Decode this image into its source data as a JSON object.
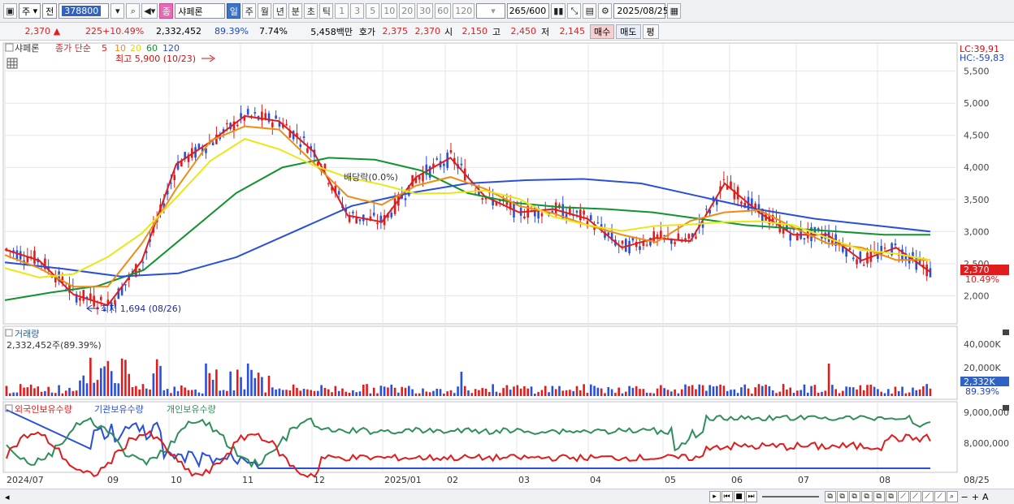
{
  "toolbar": {
    "tab_ju": "주",
    "tab_jeon": "전",
    "code": "378800",
    "name_badge": "종",
    "stock_name": "샤페론",
    "periods": [
      "일",
      "주",
      "월",
      "년",
      "분",
      "초",
      "틱"
    ],
    "intervals": [
      "1",
      "3",
      "5",
      "10",
      "20",
      "30",
      "60",
      "120"
    ],
    "count": "265",
    "count_total": "/600",
    "date": "2025/08/25"
  },
  "quote": {
    "price": "2,370",
    "arrow": "▲",
    "change": "225",
    "change_pct": "+10.49%",
    "volume": "2,332,452",
    "vol_ratio": "89.39%",
    "turnover": "7.74%",
    "amount": "5,458백만",
    "ask_label": "호가",
    "ask1": "2,375",
    "ask2": "2,370",
    "open_label": "시",
    "open": "2,150",
    "high_label": "고",
    "high": "2,450",
    "low_label": "저",
    "low": "2,145",
    "buy": "매수",
    "sell": "매도",
    "avg": "평"
  },
  "price_chart": {
    "stock_label": "샤페론",
    "ma_title": "종가 단순",
    "ma_periods": [
      "5",
      "10",
      "20",
      "60",
      "120"
    ],
    "ma_colors": [
      "#e01c1c",
      "#f08c14",
      "#e8e818",
      "#13922f",
      "#2a4fd8"
    ],
    "high_annot": "최고 5,900 (10/23)",
    "low_annot": "최저 1,694 (08/26)",
    "dividend_annot": "배당락(0.0%)",
    "lc": "LC:39,91",
    "hc": "HC:-59,83",
    "y_ticks": [
      "5,500",
      "5,000",
      "4,500",
      "4,000",
      "3,500",
      "3,000",
      "2,500",
      "2,000"
    ],
    "last_price": "2,370",
    "last_pct": "10.49%"
  },
  "volume_chart": {
    "title": "거래량",
    "value": "2,332,452주(89.39%)",
    "y_ticks": [
      "40,000K",
      "20,000K"
    ],
    "last": "2,332K",
    "last_pct": "89.39%"
  },
  "holding_chart": {
    "legend": [
      "외국인보유수량",
      "기관보유수량",
      "개인보유수량"
    ],
    "legend_colors": [
      "#e01c1c",
      "#2a4fd8",
      "#2f8f5a"
    ],
    "y_ticks": [
      "9,000,000",
      "8,000,000"
    ]
  },
  "x_axis": {
    "labels": [
      "2024/07",
      "09",
      "10",
      "11",
      "12",
      "2025/01",
      "02",
      "03",
      "04",
      "05",
      "06",
      "07",
      "08"
    ],
    "last_label": "08/25"
  },
  "chart_data": {
    "type": "line",
    "title": "",
    "series": [
      {
        "name": "5",
        "values": [
          2.72,
          2.55,
          2.02,
          1.85,
          2.55,
          4.05,
          4.4,
          4.8,
          4.72,
          4.25,
          3.25,
          3.15,
          3.85,
          4.15,
          3.55,
          3.3,
          3.35,
          3.2,
          2.75,
          2.9,
          2.85,
          3.75,
          3.3,
          2.95,
          2.95,
          2.55,
          2.75,
          2.37
        ]
      },
      {
        "name": "60",
        "values": [
          1.93,
          2.05,
          2.15,
          2.4,
          3.0,
          3.6,
          4.0,
          4.15,
          4.12,
          3.95,
          3.6,
          3.45,
          3.38,
          3.35,
          3.3,
          3.2,
          3.1,
          3.05,
          3.0,
          2.95,
          2.95
        ]
      },
      {
        "name": "120",
        "values": [
          2.52,
          2.42,
          2.3,
          2.35,
          2.6,
          3.0,
          3.4,
          3.6,
          3.75,
          3.8,
          3.82,
          3.75,
          3.55,
          3.35,
          3.2,
          3.1,
          3.0
        ]
      }
    ],
    "ylim": [
      1.6,
      5.9
    ],
    "xlabel": "",
    "ylabel": ""
  }
}
